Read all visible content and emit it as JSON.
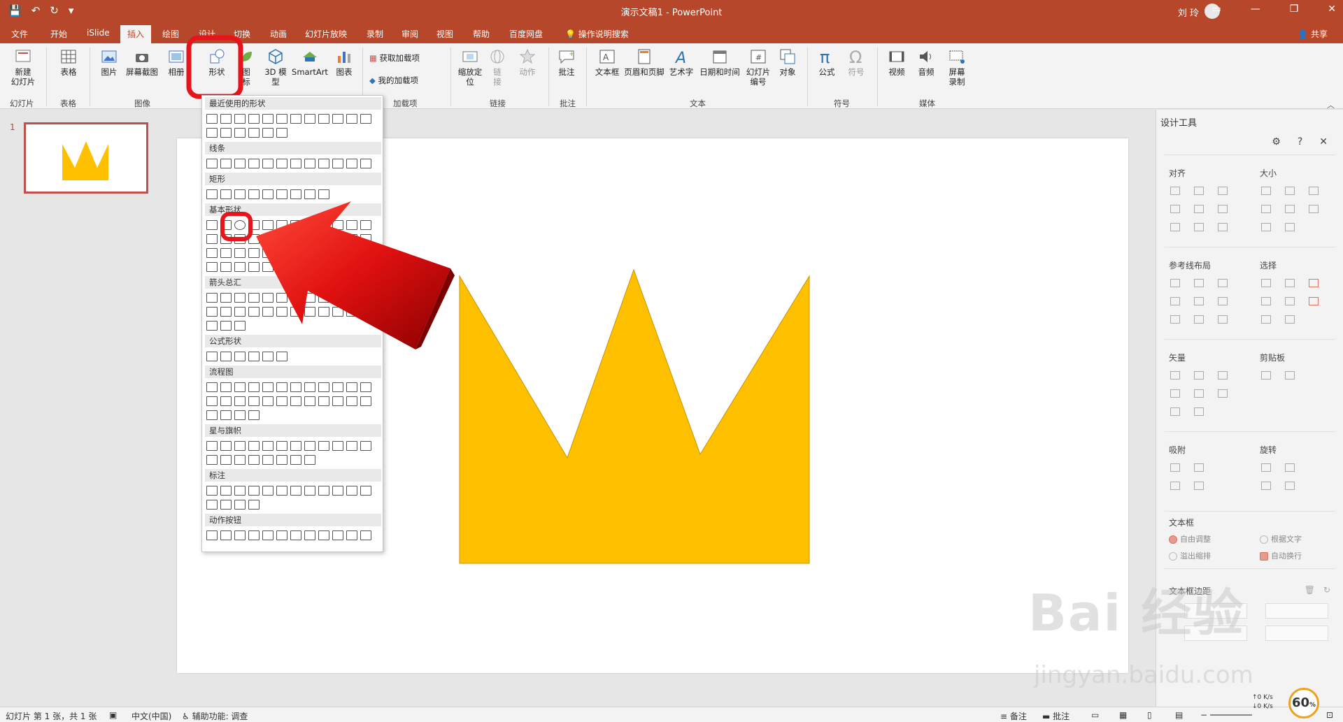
{
  "window": {
    "title": "演示文稿1 - PowerPoint",
    "user": "刘 玲"
  },
  "tabs": [
    "文件",
    "开始",
    "iSlide",
    "插入",
    "绘图",
    "设计",
    "切换",
    "动画",
    "幻灯片放映",
    "录制",
    "审阅",
    "视图",
    "帮助",
    "百度网盘"
  ],
  "active_tab": "插入",
  "tell_me": "操作说明搜索",
  "share": "共享",
  "ribbon": {
    "new_slide": "新建\n幻灯片",
    "table": "表格",
    "picture": "图片",
    "screenshot": "屏幕截图",
    "album": "相册",
    "shapes": "形状",
    "icons": "图\n标",
    "model3d": "3D 模\n型",
    "smartart": "SmartArt",
    "chart": "图表",
    "get_addins": "获取加载项",
    "my_addins": "我的加载项",
    "zoom": "缩放定\n位",
    "link": "链\n接",
    "action": "动作",
    "comment": "批注",
    "textbox": "文本框",
    "header_footer": "页眉和页脚",
    "wordart": "艺术字",
    "datetime": "日期和时间",
    "slide_number": "幻灯片\n编号",
    "object": "对象",
    "equation": "公式",
    "symbol": "符号",
    "video": "视频",
    "audio": "音频",
    "screen_record": "屏幕\n录制",
    "groups": {
      "slides": "幻灯片",
      "tables": "表格",
      "images": "图像",
      "addins": "加载项",
      "links": "链接",
      "comments": "批注",
      "text": "文本",
      "symbols": "符号",
      "media": "媒体"
    }
  },
  "gallery": {
    "sections": [
      "最近使用的形状",
      "线条",
      "矩形",
      "基本形状",
      "箭头总汇",
      "公式形状",
      "流程图",
      "星与旗帜",
      "标注",
      "动作按钮"
    ]
  },
  "slide_pane": {
    "number": "1"
  },
  "slide": {
    "crown_color": "#FFC000"
  },
  "design_pane": {
    "title": "设计工具",
    "sections": {
      "align": "对齐",
      "size": "大小",
      "guides": "参考线布局",
      "select": "选择",
      "vector": "矢量",
      "clipboard": "剪贴板",
      "snap": "吸附",
      "rotate": "旋转",
      "textbox": "文本框",
      "margin": "文本框边距"
    },
    "options": {
      "auto_fit": "自由调整",
      "fit_text": "根据文字",
      "overflow": "溢出缩排",
      "auto_wrap": "自动换行"
    }
  },
  "status": {
    "slide_info": "幻灯片 第 1 张，共 1 张",
    "language": "中文(中国)",
    "accessibility": "辅助功能: 调查",
    "notes": "备注",
    "comments": "批注",
    "zoom": "60",
    "up_speed": "0  K/s",
    "down_speed": "0  K/s"
  },
  "watermark": {
    "brand": "Bai 经验",
    "url": "jingyan.baidu.com"
  },
  "colors": {
    "accent": "#B7472A",
    "highlight": "#E8141C",
    "arrow": "#E01010"
  }
}
